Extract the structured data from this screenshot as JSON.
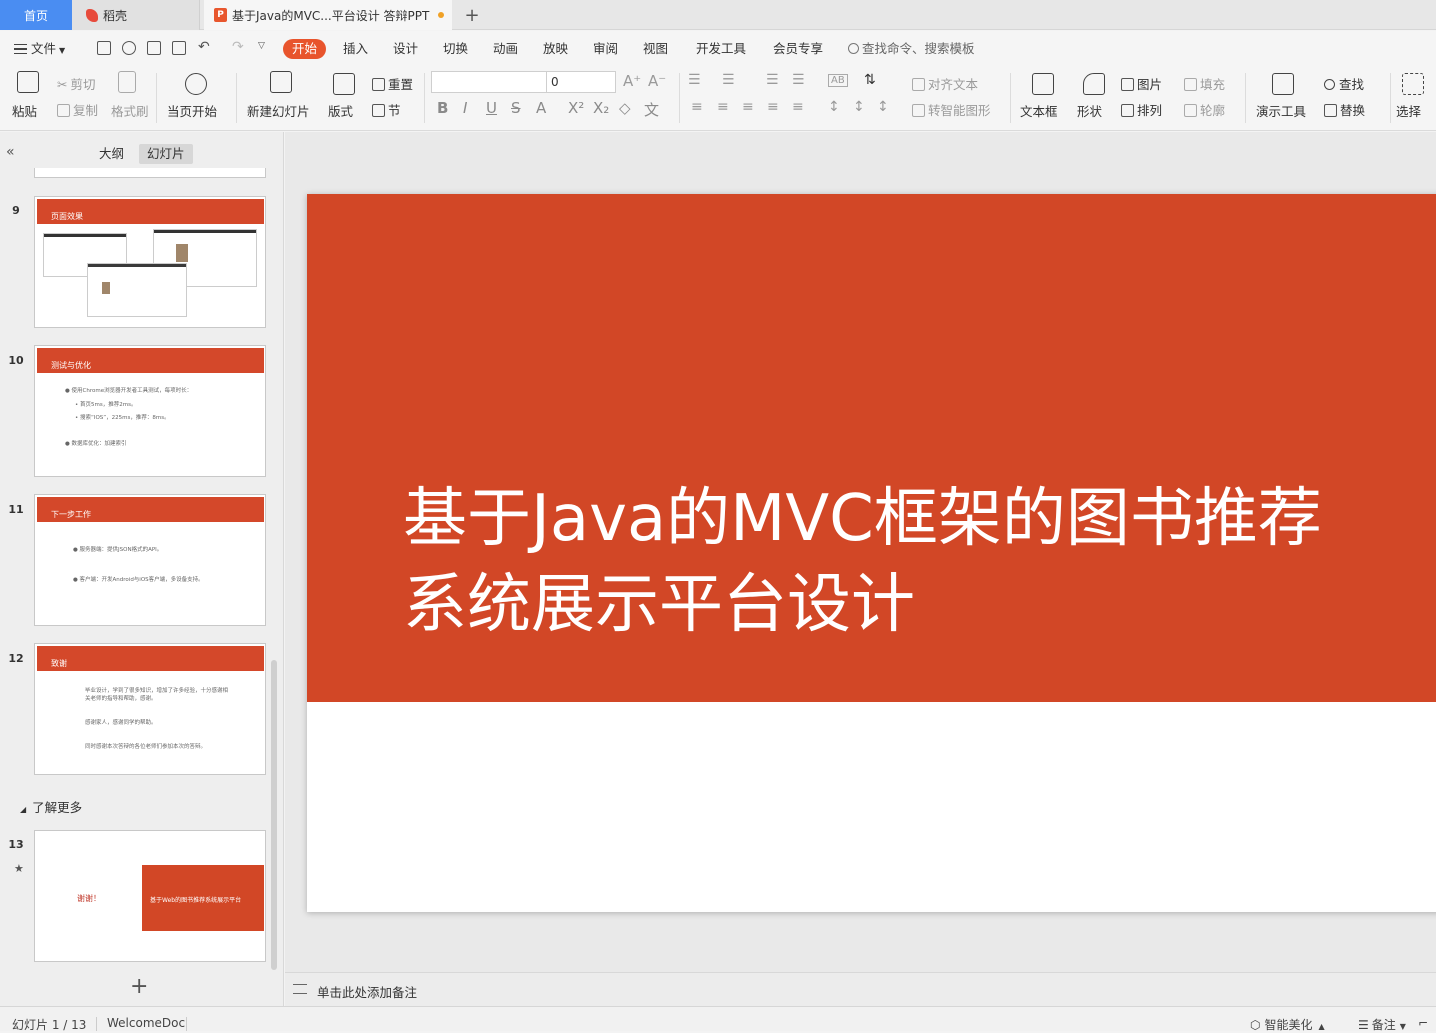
{
  "tabs": {
    "home": "首页",
    "daoke": "稻壳",
    "document": "基于Java的MVC...平台设计 答辩PPT",
    "add": "+"
  },
  "menu": {
    "file": "文件",
    "items": [
      "开始",
      "插入",
      "设计",
      "切换",
      "动画",
      "放映",
      "审阅",
      "视图",
      "开发工具",
      "会员专享"
    ],
    "search": "查找命令、搜索模板"
  },
  "ribbon": {
    "paste": "粘贴",
    "cut": "剪切",
    "copy": "复制",
    "format_painter": "格式刷",
    "from_current": "当页开始",
    "new_slide": "新建幻灯片",
    "layout": "版式",
    "reset": "重置",
    "section": "节",
    "font_name": "",
    "font_size": "0",
    "align_text": "对齐文本",
    "smart_art": "转智能图形",
    "textbox": "文本框",
    "shape": "形状",
    "picture": "图片",
    "arrange": "排列",
    "fill": "填充",
    "outline": "轮廓",
    "present_tools": "演示工具",
    "find": "查找",
    "replace": "替换",
    "select": "选择"
  },
  "sidebar": {
    "outline_tab": "大纲",
    "slides_tab": "幻灯片",
    "section_label": "了解更多",
    "add": "+",
    "slides": [
      {
        "num": "9",
        "title": "页面效果"
      },
      {
        "num": "10",
        "title": "测试与优化",
        "lines": [
          "● 使用Chrome浏览器开发者工具测试，每项时长：",
          "• 首页5ms，推荐2ms。",
          "• 搜索“IOS”，225ms，推荐：8ms。",
          "● 数据库优化：加建索引"
        ]
      },
      {
        "num": "11",
        "title": "下一步工作",
        "lines": [
          "● 服务器端：提供JSON格式的API。",
          "● 客户端：开发Android与iOS客户端，多设备支持。"
        ]
      },
      {
        "num": "12",
        "title": "致谢",
        "lines": [
          "毕业设计，学到了很多知识，增加了许多经验，十分感谢相",
          "关老师的指导和帮助，感谢。",
          "感谢家人，感谢同学的帮助。",
          "同时感谢本次答辩的各位老师们参加本次的答辩。"
        ]
      },
      {
        "num": "13",
        "left_text": "谢谢！",
        "right_text": "基于Web的图书推荐系统展示平台"
      }
    ]
  },
  "slide": {
    "title": "基于Java的MVC框架的图书推荐\n系统展示平台设计"
  },
  "notes": {
    "placeholder": "单击此处添加备注"
  },
  "status": {
    "slide_counter": "幻灯片 1 / 13",
    "theme": "WelcomeDoc",
    "beautify": "智能美化",
    "notes": "备注"
  },
  "colors": {
    "accent": "#e8542c",
    "slide_band": "#d24726",
    "home_tab": "#4a8df2"
  }
}
